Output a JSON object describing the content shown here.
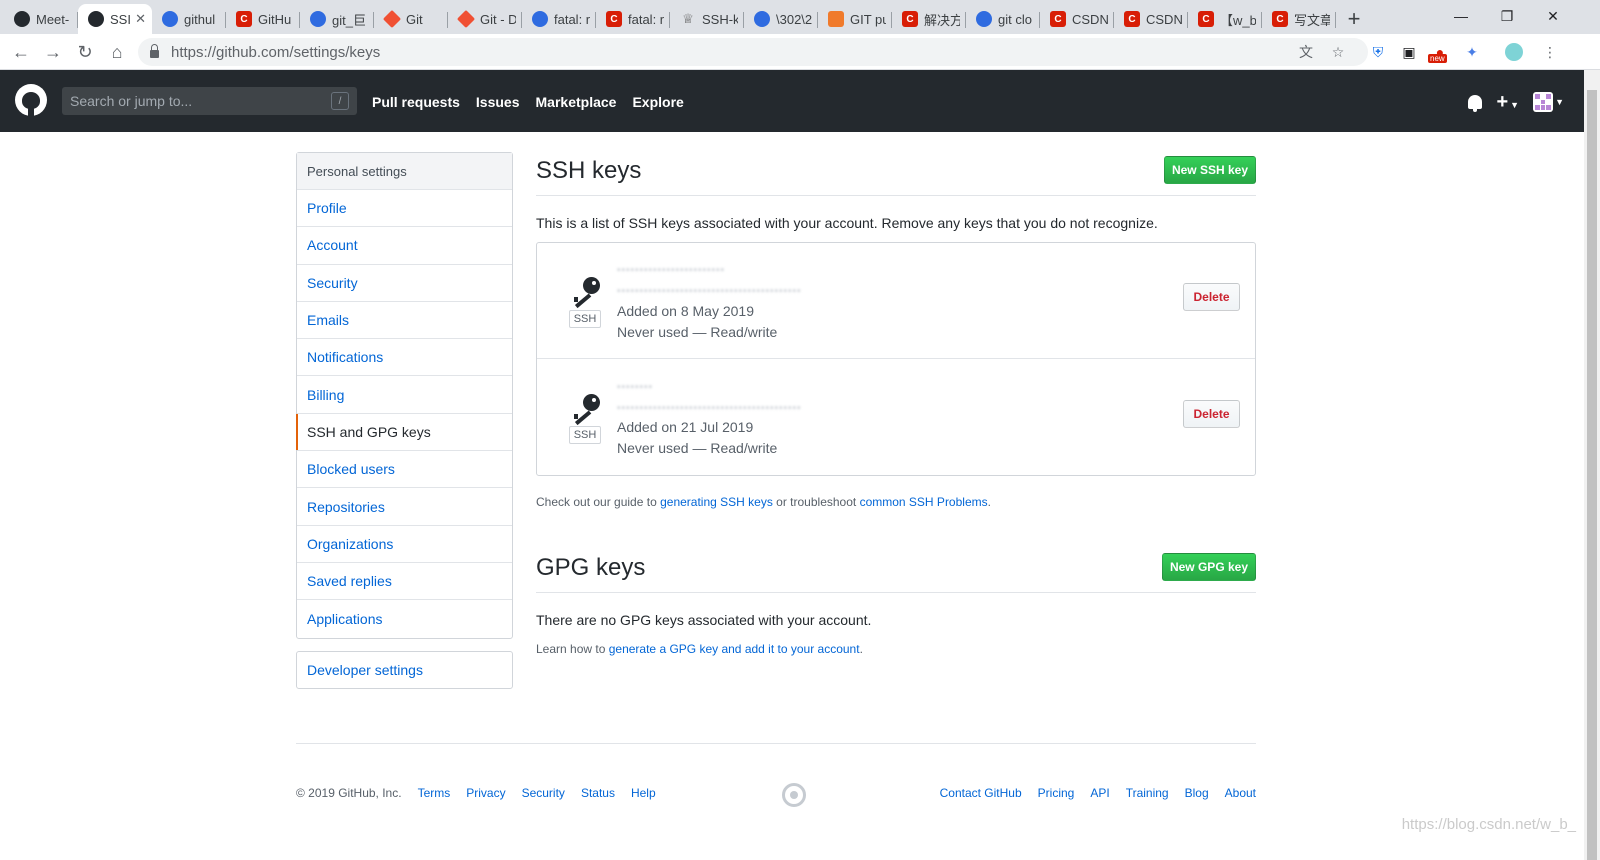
{
  "browser": {
    "tabs": [
      {
        "label": "Meet-",
        "favicon": "github-icon",
        "active": false
      },
      {
        "label": "SSI",
        "favicon": "github-icon",
        "active": true
      },
      {
        "label": "githul",
        "favicon": "baidu-icon",
        "active": false
      },
      {
        "label": "GitHu",
        "favicon": "csdn-icon",
        "active": false
      },
      {
        "label": "git_巨",
        "favicon": "baidu-icon",
        "active": false
      },
      {
        "label": "Git",
        "favicon": "git-icon",
        "active": false
      },
      {
        "label": "Git - D",
        "favicon": "git-icon",
        "active": false
      },
      {
        "label": "fatal: r",
        "favicon": "baidu-icon",
        "active": false
      },
      {
        "label": "fatal: r",
        "favicon": "csdn-icon",
        "active": false
      },
      {
        "label": "SSH-k",
        "favicon": "fish-icon",
        "active": false
      },
      {
        "label": "\\302\\2",
        "favicon": "baidu-icon",
        "active": false
      },
      {
        "label": "GIT pu",
        "favicon": "fire-icon",
        "active": false
      },
      {
        "label": "解决方",
        "favicon": "csdn-icon",
        "active": false
      },
      {
        "label": "git clo",
        "favicon": "baidu-icon",
        "active": false
      },
      {
        "label": "CSDN",
        "favicon": "csdn-icon",
        "active": false
      },
      {
        "label": "CSDN",
        "favicon": "csdn-icon",
        "active": false
      },
      {
        "label": "【w_b",
        "favicon": "csdn-icon",
        "active": false
      },
      {
        "label": "写文章",
        "favicon": "csdn-icon",
        "active": false
      }
    ],
    "url": "https://github.com/settings/keys",
    "ext_badge": "new"
  },
  "header": {
    "search_placeholder": "Search or jump to...",
    "search_shortcut": "/",
    "nav": [
      "Pull requests",
      "Issues",
      "Marketplace",
      "Explore"
    ]
  },
  "sidebar": {
    "heading": "Personal settings",
    "items": [
      {
        "label": "Profile",
        "selected": false
      },
      {
        "label": "Account",
        "selected": false
      },
      {
        "label": "Security",
        "selected": false
      },
      {
        "label": "Emails",
        "selected": false
      },
      {
        "label": "Notifications",
        "selected": false
      },
      {
        "label": "Billing",
        "selected": false
      },
      {
        "label": "SSH and GPG keys",
        "selected": true
      },
      {
        "label": "Blocked users",
        "selected": false
      },
      {
        "label": "Repositories",
        "selected": false
      },
      {
        "label": "Organizations",
        "selected": false
      },
      {
        "label": "Saved replies",
        "selected": false
      },
      {
        "label": "Applications",
        "selected": false
      }
    ],
    "developer_settings": "Developer settings"
  },
  "ssh": {
    "title": "SSH keys",
    "new_button": "New SSH key",
    "description": "This is a list of SSH keys associated with your account. Remove any keys that you do not recognize.",
    "keys": [
      {
        "type_label": "SSH",
        "added": "Added on 8 May 2019",
        "usage": "Never used — Read/write",
        "delete_label": "Delete"
      },
      {
        "type_label": "SSH",
        "added": "Added on 21 Jul 2019",
        "usage": "Never used — Read/write",
        "delete_label": "Delete"
      }
    ],
    "guide_prefix": "Check out our guide to",
    "guide_link": "generating SSH keys",
    "guide_mid": "or troubleshoot",
    "guide_link2": "common SSH Problems",
    "guide_end": "."
  },
  "gpg": {
    "title": "GPG keys",
    "new_button": "New GPG key",
    "empty_text": "There are no GPG keys associated with your account.",
    "learn_prefix": "Learn how to",
    "learn_link": "generate a GPG key and add it to your account",
    "learn_end": "."
  },
  "footer": {
    "copyright": "© 2019 GitHub, Inc.",
    "left_links": [
      "Terms",
      "Privacy",
      "Security",
      "Status",
      "Help"
    ],
    "right_links": [
      "Contact GitHub",
      "Pricing",
      "API",
      "Training",
      "Blog",
      "About"
    ]
  },
  "watermark": "https://blog.csdn.net/w_b_"
}
